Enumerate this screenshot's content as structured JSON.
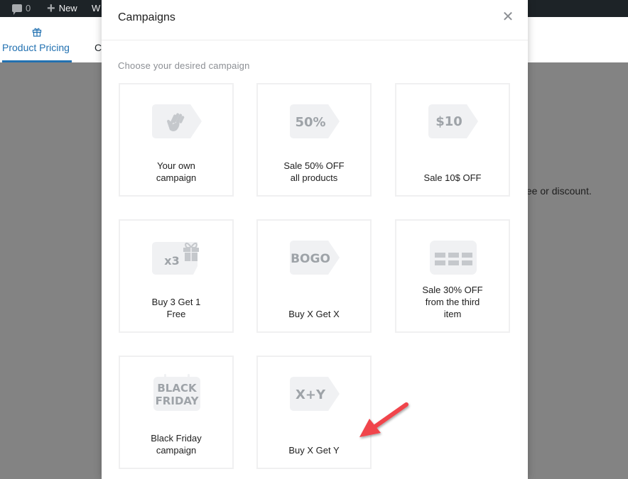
{
  "admin_bar": {
    "comments_count": "0",
    "new_label": "New",
    "truncated_item": "W"
  },
  "tabs": [
    {
      "label": "Product Pricing",
      "icon": "gift-icon",
      "active": true
    },
    {
      "label": "C",
      "active": false
    }
  ],
  "background_text": "fee or discount.",
  "modal": {
    "title": "Campaigns",
    "close_icon": "close-icon",
    "subtitle": "Choose your desired campaign",
    "cards": [
      {
        "id": "your-own",
        "icon": "hand-tag-icon",
        "lines": [
          "Your own",
          "campaign"
        ]
      },
      {
        "id": "sale-50",
        "icon": "tag-icon",
        "tag_text": "50%",
        "lines": [
          "Sale 50% OFF",
          "all products"
        ]
      },
      {
        "id": "sale-10",
        "icon": "tag-icon",
        "tag_text": "$10",
        "lines": [
          "Sale 10$ OFF"
        ]
      },
      {
        "id": "buy3get1",
        "icon": "gift-tag-icon",
        "tag_text": "x3",
        "lines": [
          "Buy 3 Get 1",
          "Free"
        ]
      },
      {
        "id": "bogo",
        "icon": "tag-icon",
        "tag_text": "BOGO",
        "lines": [
          "Buy X Get X"
        ]
      },
      {
        "id": "sale-30-third",
        "icon": "grid-icon",
        "lines": [
          "Sale 30% OFF",
          "from the third",
          "item"
        ]
      },
      {
        "id": "black-friday",
        "icon": "calendar-icon",
        "tag_text": [
          "BLACK",
          "FRIDAY"
        ],
        "lines": [
          "Black Friday",
          "campaign"
        ]
      },
      {
        "id": "buy-x-get-y",
        "icon": "tag-icon",
        "tag_text": "X+Y",
        "lines": [
          "Buy X Get Y"
        ]
      }
    ]
  },
  "colors": {
    "accent": "#2271b1",
    "admin_bar": "#1d2327",
    "overlay": "#838383",
    "icon_bg": "#f0f1f3",
    "icon_fg": "#9ea3a8",
    "annotation_arrow": "#f0444b"
  }
}
